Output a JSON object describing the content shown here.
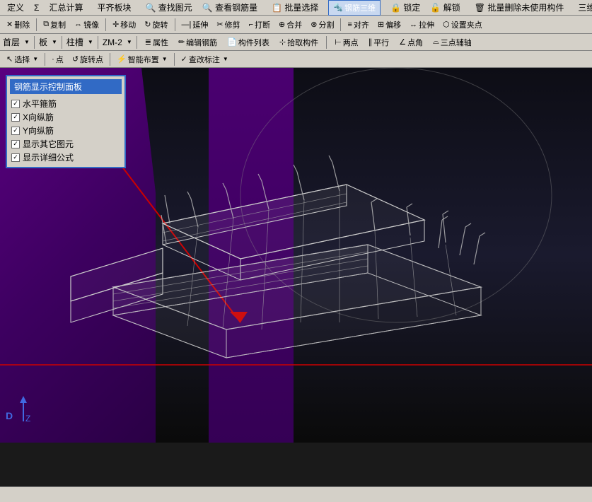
{
  "menu": {
    "items": [
      "定义",
      "Σ",
      "汇总计算",
      "平齐板块",
      "查找图元",
      "查看钢筋量",
      "批量选择",
      "钢筋三维",
      "锁定",
      "解锁",
      "批量删除未使用构件",
      "三维"
    ]
  },
  "toolbar1": {
    "items": [
      "删除",
      "复制",
      "镜像",
      "移动",
      "旋转",
      "延伸",
      "修剪",
      "打断",
      "合并",
      "分割",
      "对齐",
      "偏移",
      "拉伸",
      "设置夹点"
    ]
  },
  "toolbar2": {
    "layer": "首层",
    "type": "板",
    "col": "柱槽",
    "zoom": "ZM-2",
    "items": [
      "属性",
      "编辑钢筋",
      "构件列表",
      "拾取构件",
      "两点",
      "平行",
      "点角",
      "三点辅轴"
    ]
  },
  "toolbar3": {
    "items": [
      "选择",
      "点",
      "旋转点",
      "智能布置",
      "查改标注"
    ]
  },
  "controlPanel": {
    "title": "钢筋显示控制面板",
    "items": [
      {
        "label": "水平箍筋",
        "checked": true
      },
      {
        "label": "X向纵筋",
        "checked": true
      },
      {
        "label": "Y向纵筋",
        "checked": true
      },
      {
        "label": "显示其它图元",
        "checked": true
      },
      {
        "label": "显示详细公式",
        "checked": true
      }
    ]
  },
  "statusBar": {
    "text": ""
  },
  "axisLabels": {
    "d": "D",
    "z": "Z"
  },
  "colors": {
    "accent": "#316ac5",
    "purple_dark": "#3d0060",
    "purple_mid": "#5a0080",
    "wireframe": "#e0e0e0",
    "red_arrow": "#cc0000"
  }
}
